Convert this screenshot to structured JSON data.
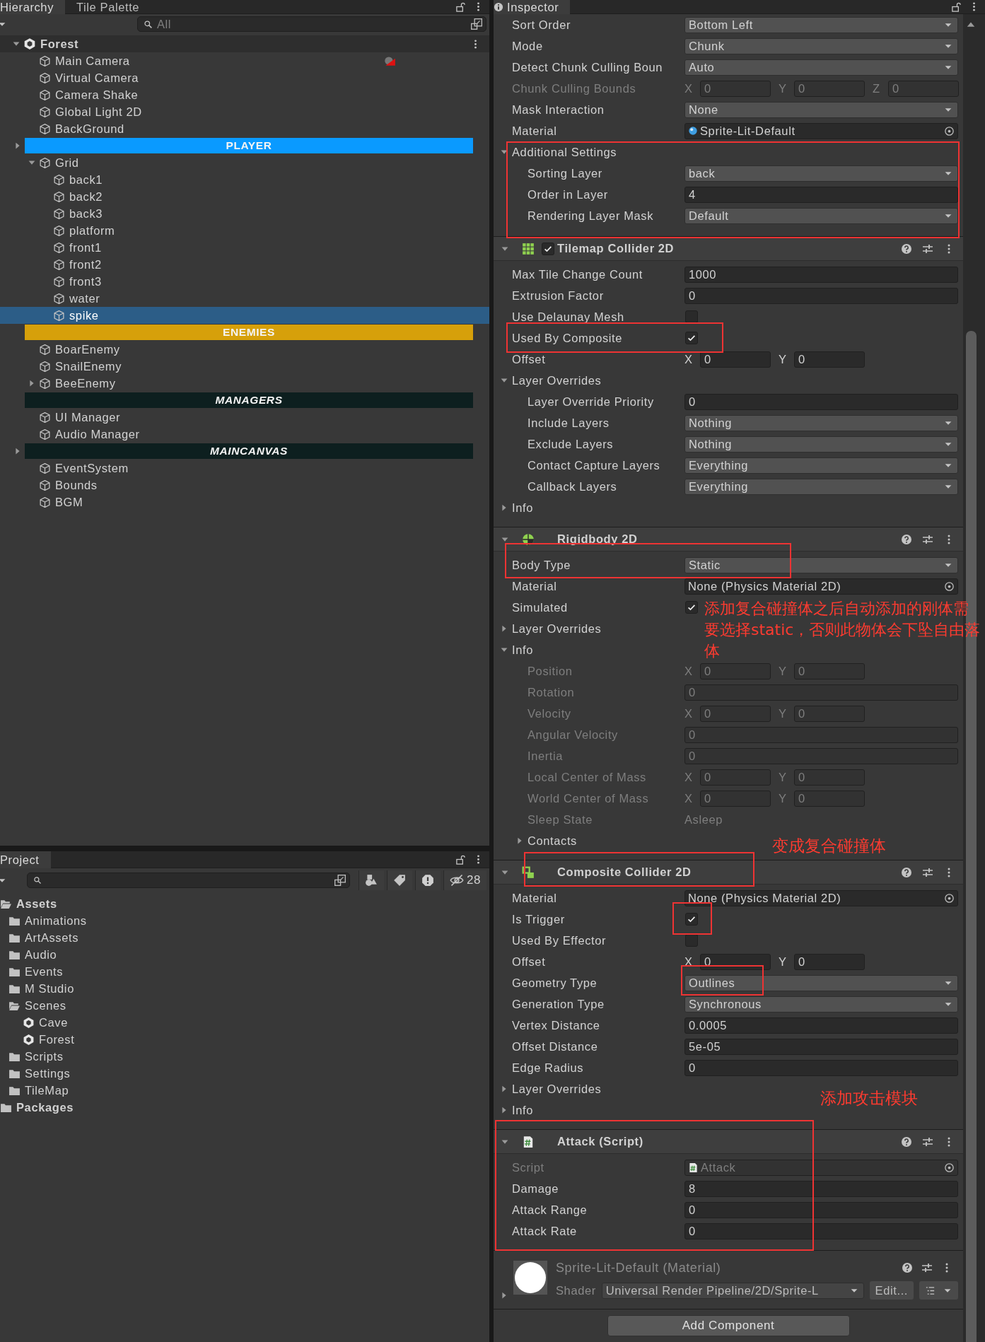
{
  "hierarchy": {
    "tabs": [
      {
        "label": "Hierarchy",
        "selected": true
      },
      {
        "label": "Tile Palette",
        "selected": false
      }
    ],
    "search": {
      "placeholder": "All"
    },
    "scene": {
      "name": "Forest",
      "expanded": true,
      "children": [
        {
          "kind": "object",
          "name": "Main Camera",
          "selected": false,
          "gizmo": true
        },
        {
          "kind": "object",
          "name": "Virtual Camera",
          "selected": false
        },
        {
          "kind": "object",
          "name": "Camera Shake",
          "selected": false
        },
        {
          "kind": "object",
          "name": "Global Light 2D",
          "selected": false
        },
        {
          "kind": "object",
          "name": "BackGround",
          "selected": false
        },
        {
          "kind": "header",
          "name": "PLAYER",
          "color": "#0a9aff",
          "italic": false,
          "expanded": false,
          "selected": false
        },
        {
          "kind": "object",
          "name": "Grid",
          "selected": false,
          "expanded": true,
          "children": [
            {
              "kind": "object",
              "name": "back1",
              "selected": false
            },
            {
              "kind": "object",
              "name": "back2",
              "selected": false
            },
            {
              "kind": "object",
              "name": "back3",
              "selected": false
            },
            {
              "kind": "object",
              "name": "platform",
              "selected": false
            },
            {
              "kind": "object",
              "name": "front1",
              "selected": false
            },
            {
              "kind": "object",
              "name": "front2",
              "selected": false
            },
            {
              "kind": "object",
              "name": "front3",
              "selected": false
            },
            {
              "kind": "object",
              "name": "water",
              "selected": false
            },
            {
              "kind": "object",
              "name": "spike",
              "selected": true
            }
          ]
        },
        {
          "kind": "header",
          "name": "ENEMIES",
          "color": "#d6a00a",
          "italic": false,
          "selected": false
        },
        {
          "kind": "object",
          "name": "BoarEnemy",
          "selected": false
        },
        {
          "kind": "object",
          "name": "SnailEnemy",
          "selected": false
        },
        {
          "kind": "object",
          "name": "BeeEnemy",
          "selected": false,
          "expanded": false
        },
        {
          "kind": "header",
          "name": "MANAGERS",
          "color": "#0d1f1f",
          "italic": true,
          "selected": false
        },
        {
          "kind": "object",
          "name": "UI Manager",
          "selected": false
        },
        {
          "kind": "object",
          "name": "Audio Manager",
          "selected": false
        },
        {
          "kind": "header",
          "name": "MAINCANVAS",
          "color": "#0d1f1f",
          "italic": true,
          "expanded": false,
          "selected": false
        },
        {
          "kind": "object",
          "name": "EventSystem",
          "selected": false
        },
        {
          "kind": "object",
          "name": "Bounds",
          "selected": false
        },
        {
          "kind": "object",
          "name": "BGM",
          "selected": false
        }
      ]
    }
  },
  "project": {
    "tabs": [
      {
        "label": "Project",
        "selected": true
      }
    ],
    "hidden_count": "28",
    "tree": [
      {
        "kind": "root",
        "name": "Assets",
        "expanded": true,
        "children": [
          {
            "kind": "folder",
            "name": "Animations",
            "expanded": false
          },
          {
            "kind": "folder",
            "name": "ArtAssets",
            "expanded": false
          },
          {
            "kind": "folder",
            "name": "Audio",
            "expanded": false
          },
          {
            "kind": "folder",
            "name": "Events",
            "expanded": false
          },
          {
            "kind": "folder",
            "name": "M Studio",
            "expanded": false
          },
          {
            "kind": "folder",
            "name": "Scenes",
            "expanded": true,
            "children": [
              {
                "kind": "scene",
                "name": "Cave"
              },
              {
                "kind": "scene",
                "name": "Forest"
              }
            ]
          },
          {
            "kind": "folder",
            "name": "Scripts",
            "expanded": false
          },
          {
            "kind": "folder",
            "name": "Settings",
            "expanded": false
          },
          {
            "kind": "folder",
            "name": "TileMap",
            "expanded": false
          }
        ]
      },
      {
        "kind": "root",
        "name": "Packages",
        "expanded": false
      }
    ]
  },
  "inspector": {
    "tab": {
      "label": "Inspector",
      "selected": true
    },
    "rows": [
      {
        "kind": "dropdown",
        "label": "Sort Order",
        "value": "Bottom Left",
        "disabled": false
      },
      {
        "kind": "dropdown",
        "label": "Mode",
        "value": "Chunk",
        "disabled": false
      },
      {
        "kind": "dropdown",
        "label": "Detect Chunk Culling Boun",
        "value": "Auto",
        "disabled": false
      },
      {
        "kind": "vector",
        "label": "Chunk Culling Bounds",
        "disabled": true,
        "axes": [
          {
            "axis": "X",
            "value": "0"
          },
          {
            "axis": "Y",
            "value": "0"
          },
          {
            "axis": "Z",
            "value": "0"
          }
        ]
      },
      {
        "kind": "dropdown",
        "label": "Mask Interaction",
        "value": "None",
        "disabled": false
      },
      {
        "kind": "material-ref",
        "label": "Material",
        "value": "Sprite-Lit-Default",
        "disabled": false
      },
      {
        "kind": "foldout",
        "label": "Additional Settings",
        "expanded": true,
        "children": [
          {
            "kind": "dropdown",
            "label": "Sorting Layer",
            "value": "back",
            "disabled": false
          },
          {
            "kind": "field",
            "label": "Order in Layer",
            "value": "4",
            "disabled": false
          },
          {
            "kind": "dropdown",
            "label": "Rendering Layer Mask",
            "value": "Default",
            "disabled": false
          }
        ]
      }
    ],
    "components": [
      {
        "kind": "tilemap-collider",
        "title": "Tilemap Collider 2D",
        "expanded": true,
        "enabled": true,
        "rows": [
          {
            "kind": "field",
            "label": "Max Tile Change Count",
            "value": "1000",
            "disabled": false
          },
          {
            "kind": "field",
            "label": "Extrusion Factor",
            "value": "0",
            "disabled": false
          },
          {
            "kind": "checkbox",
            "label": "Use Delaunay Mesh",
            "checked": false,
            "disabled": false
          },
          {
            "kind": "checkbox",
            "label": "Used By Composite",
            "checked": true,
            "disabled": false
          },
          {
            "kind": "vector",
            "label": "Offset",
            "disabled": false,
            "axes": [
              {
                "axis": "X",
                "value": "0"
              },
              {
                "axis": "Y",
                "value": "0"
              }
            ]
          },
          {
            "kind": "foldout",
            "label": "Layer Overrides",
            "expanded": true,
            "children": [
              {
                "kind": "field",
                "label": "Layer Override Priority",
                "value": "0",
                "disabled": false
              },
              {
                "kind": "dropdown",
                "label": "Include Layers",
                "value": "Nothing",
                "disabled": false
              },
              {
                "kind": "dropdown",
                "label": "Exclude Layers",
                "value": "Nothing",
                "disabled": false
              },
              {
                "kind": "dropdown",
                "label": "Contact Capture Layers",
                "value": "Everything",
                "disabled": false
              },
              {
                "kind": "dropdown",
                "label": "Callback Layers",
                "value": "Everything",
                "disabled": false
              }
            ]
          },
          {
            "kind": "foldout",
            "label": "Info",
            "expanded": false
          }
        ]
      },
      {
        "kind": "rigidbody",
        "title": "Rigidbody 2D",
        "expanded": true,
        "rows": [
          {
            "kind": "dropdown",
            "label": "Body Type",
            "value": "Static",
            "disabled": false
          },
          {
            "kind": "object",
            "label": "Material",
            "value": "None (Physics Material 2D)",
            "disabled": false
          },
          {
            "kind": "checkbox",
            "label": "Simulated",
            "checked": true,
            "disabled": false
          },
          {
            "kind": "foldout",
            "label": "Layer Overrides",
            "expanded": false
          },
          {
            "kind": "foldout",
            "label": "Info",
            "expanded": true,
            "children": [
              {
                "kind": "vector",
                "label": "Position",
                "disabled": true,
                "axes": [
                  {
                    "axis": "X",
                    "value": "0"
                  },
                  {
                    "axis": "Y",
                    "value": "0"
                  }
                ]
              },
              {
                "kind": "field",
                "label": "Rotation",
                "value": "0",
                "disabled": true
              },
              {
                "kind": "vector",
                "label": "Velocity",
                "disabled": true,
                "axes": [
                  {
                    "axis": "X",
                    "value": "0"
                  },
                  {
                    "axis": "Y",
                    "value": "0"
                  }
                ]
              },
              {
                "kind": "field",
                "label": "Angular Velocity",
                "value": "0",
                "disabled": true
              },
              {
                "kind": "field",
                "label": "Inertia",
                "value": "0",
                "disabled": true
              },
              {
                "kind": "vector",
                "label": "Local Center of Mass",
                "disabled": true,
                "axes": [
                  {
                    "axis": "X",
                    "value": "0"
                  },
                  {
                    "axis": "Y",
                    "value": "0"
                  }
                ]
              },
              {
                "kind": "vector",
                "label": "World Center of Mass",
                "disabled": true,
                "axes": [
                  {
                    "axis": "X",
                    "value": "0"
                  },
                  {
                    "axis": "Y",
                    "value": "0"
                  }
                ]
              },
              {
                "kind": "readonly",
                "label": "Sleep State",
                "value": "Asleep",
                "disabled": true
              },
              {
                "kind": "foldout",
                "label": "Contacts",
                "expanded": false
              }
            ]
          }
        ]
      },
      {
        "kind": "composite-collider",
        "title": "Composite Collider 2D",
        "expanded": true,
        "rows": [
          {
            "kind": "object",
            "label": "Material",
            "value": "None (Physics Material 2D)",
            "disabled": false
          },
          {
            "kind": "checkbox",
            "label": "Is Trigger",
            "checked": true,
            "disabled": false
          },
          {
            "kind": "checkbox",
            "label": "Used By Effector",
            "checked": false,
            "disabled": false
          },
          {
            "kind": "vector",
            "label": "Offset",
            "disabled": false,
            "axes": [
              {
                "axis": "X",
                "value": "0"
              },
              {
                "axis": "Y",
                "value": "0"
              }
            ]
          },
          {
            "kind": "dropdown",
            "label": "Geometry Type",
            "value": "Outlines",
            "disabled": false
          },
          {
            "kind": "dropdown",
            "label": "Generation Type",
            "value": "Synchronous",
            "disabled": false
          },
          {
            "kind": "field",
            "label": "Vertex Distance",
            "value": "0.0005",
            "disabled": false
          },
          {
            "kind": "field",
            "label": "Offset Distance",
            "value": "5e-05",
            "disabled": false
          },
          {
            "kind": "field",
            "label": "Edge Radius",
            "value": "0",
            "disabled": false
          },
          {
            "kind": "foldout",
            "label": "Layer Overrides",
            "expanded": false
          },
          {
            "kind": "foldout",
            "label": "Info",
            "expanded": false
          }
        ]
      },
      {
        "kind": "script",
        "title": "Attack (Script)",
        "expanded": true,
        "rows": [
          {
            "kind": "script-ref",
            "label": "Script",
            "value": "Attack",
            "disabled": true
          },
          {
            "kind": "field",
            "label": "Damage",
            "value": "8",
            "disabled": false
          },
          {
            "kind": "field",
            "label": "Attack Range",
            "value": "0",
            "disabled": false
          },
          {
            "kind": "field",
            "label": "Attack Rate",
            "value": "0",
            "disabled": false
          }
        ]
      }
    ],
    "material": {
      "title": "Sprite-Lit-Default (Material)",
      "expanded": false,
      "shader_label": "Shader",
      "shader": "Universal Render Pipeline/2D/Sprite-L",
      "edit_button": "Edit..."
    },
    "add_component": "Add Component"
  },
  "annotations": [
    {
      "text": "添加复合碰撞体之后自动添加的刚体需要选择static，否则此物体会下坠自由落体"
    },
    {
      "text": "变成复合碰撞体"
    },
    {
      "text": "添加攻击模块"
    }
  ]
}
